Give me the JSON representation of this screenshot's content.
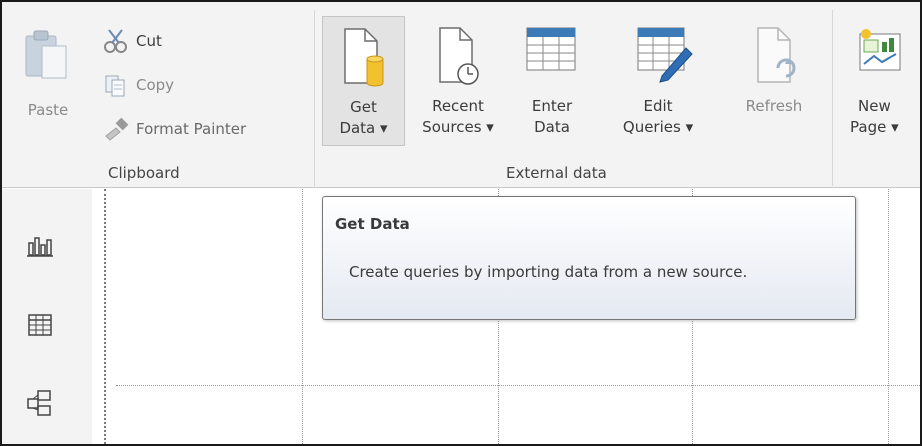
{
  "ribbon": {
    "clipboard": {
      "paste_label": "Paste",
      "cut_label": "Cut",
      "copy_label": "Copy",
      "format_painter_label": "Format Painter",
      "group_label": "Clipboard"
    },
    "external_data": {
      "get_data_line1": "Get",
      "get_data_line2": "Data ▾",
      "recent_sources_line1": "Recent",
      "recent_sources_line2": "Sources ▾",
      "enter_data_line1": "Enter",
      "enter_data_line2": "Data",
      "edit_queries_line1": "Edit",
      "edit_queries_line2": "Queries ▾",
      "refresh_label": "Refresh",
      "group_label": "External data"
    },
    "insert": {
      "new_page_line1": "New",
      "new_page_line2": "Page ▾"
    }
  },
  "tooltip": {
    "title": "Get Data",
    "description": "Create queries by importing data from a new source."
  },
  "rail": {
    "icons": [
      "report-view-icon",
      "data-view-icon",
      "relationships-view-icon"
    ]
  },
  "colors": {
    "ribbon_bg": "#f3f3f3",
    "cylinder_yellow": "#f2c12e",
    "table_blue": "#3d7ab8",
    "pencil_blue": "#2f6db5"
  }
}
